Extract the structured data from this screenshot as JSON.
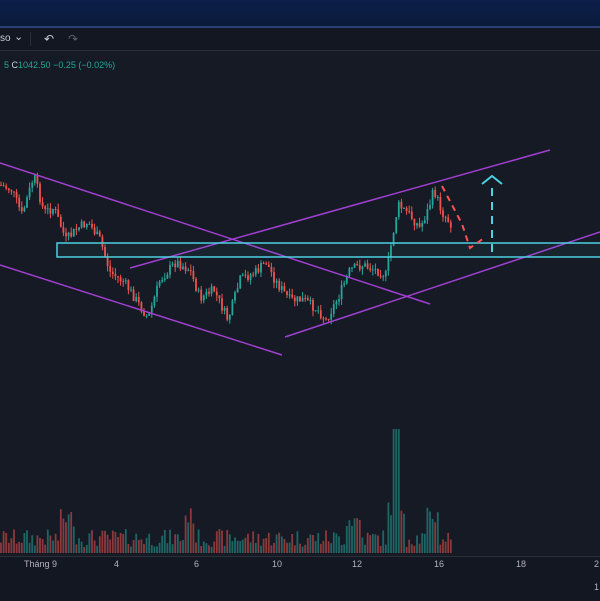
{
  "window": {
    "accent": "#2a3f7a"
  },
  "toolbar": {
    "symbol_fragment": "so",
    "dropdown_glyph": "⌄",
    "undo_glyph": "↶",
    "redo_glyph": "↷"
  },
  "legend": {
    "prefix": "5",
    "close_label": "C",
    "close_value": "1042.50",
    "change": "−0.25 (−0.02%)"
  },
  "colors": {
    "up": "#26a69a",
    "down": "#ef5350",
    "channel": "#a13fd1",
    "zone": "#4dd0e1",
    "projection_down": "#ff5252",
    "projection_up": "#4dd0e1"
  },
  "axis": {
    "labels": [
      "Tháng 9",
      "4",
      "6",
      "10",
      "12",
      "16",
      "18"
    ],
    "corner_right": "2",
    "corner_bottom": "1"
  },
  "drawings": [
    {
      "type": "trendline",
      "name": "descending-channel-upper"
    },
    {
      "type": "trendline",
      "name": "descending-channel-lower"
    },
    {
      "type": "trendline",
      "name": "ascending-channel-upper"
    },
    {
      "type": "trendline",
      "name": "ascending-channel-lower"
    },
    {
      "type": "rectangle",
      "name": "support-zone"
    },
    {
      "type": "path",
      "name": "projection-pullback"
    },
    {
      "type": "arrow",
      "name": "projection-target"
    }
  ],
  "volume_spike_relative": 1.0
}
